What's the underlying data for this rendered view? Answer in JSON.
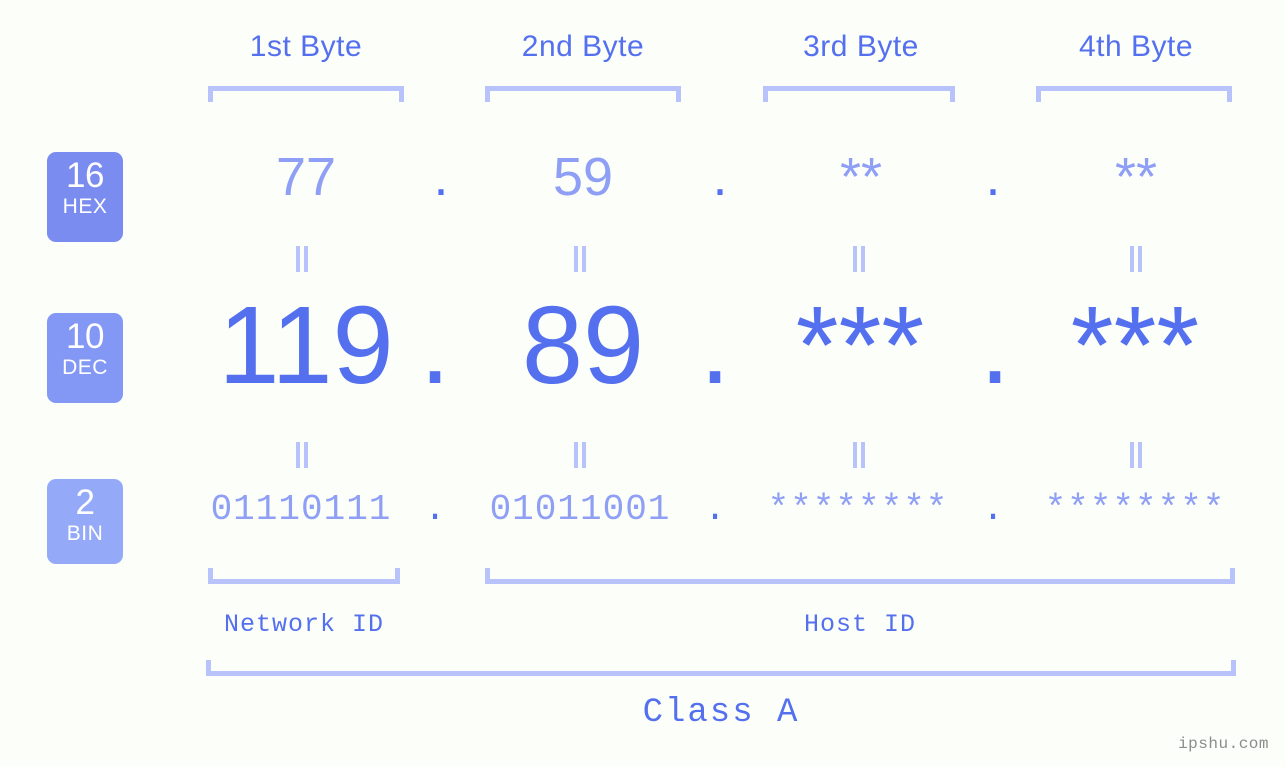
{
  "meta": {
    "watermark": "ipshu.com",
    "accent_color": "#5470ef",
    "accent_light_color": "#8e9ff5",
    "bracket_color": "#b8c2fb",
    "background_color": "#fcfef9"
  },
  "byte_headings": [
    {
      "label": "1st Byte"
    },
    {
      "label": "2nd Byte"
    },
    {
      "label": "3rd Byte"
    },
    {
      "label": "4th Byte"
    }
  ],
  "bases": [
    {
      "number": "16",
      "name": "HEX",
      "color": "#7b8cf0"
    },
    {
      "number": "10",
      "name": "DEC",
      "color": "#8397f5"
    },
    {
      "number": "2",
      "name": "BIN",
      "color": "#94aaf9"
    }
  ],
  "rows": {
    "hex": {
      "base_number": "16",
      "base_name": "HEX",
      "values": [
        "77",
        "59",
        "**",
        "**"
      ],
      "separators": [
        ".",
        ".",
        "."
      ]
    },
    "dec": {
      "base_number": "10",
      "base_name": "DEC",
      "values": [
        "119",
        "89",
        "***",
        "***"
      ],
      "separators": [
        ".",
        ".",
        "."
      ]
    },
    "bin": {
      "base_number": "2",
      "base_name": "BIN",
      "values": [
        "01110111",
        "01011001",
        "********",
        "********"
      ],
      "separators": [
        ".",
        ".",
        "."
      ]
    }
  },
  "equality_marks": {
    "symbol": "=",
    "count_per_row": 4,
    "rows": 2
  },
  "segments": [
    {
      "label": "Network ID"
    },
    {
      "label": "Host ID"
    }
  ],
  "class": {
    "label": "Class A"
  }
}
